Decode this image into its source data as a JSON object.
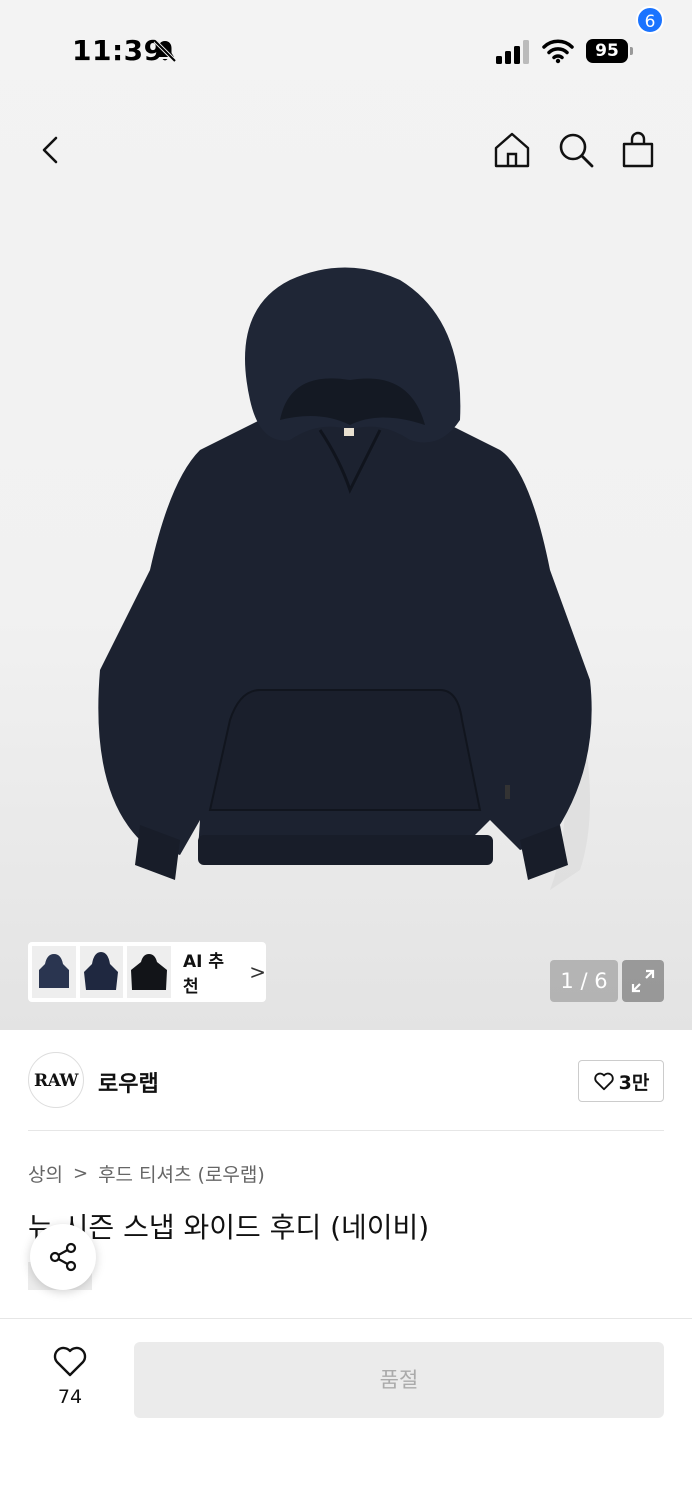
{
  "status_bar": {
    "time": "11:39",
    "battery": "95"
  },
  "nav": {
    "cart_count": "6"
  },
  "gallery": {
    "ai_label": "AI 추천",
    "ai_chevron": ">",
    "page_indicator": "1 / 6"
  },
  "brand": {
    "logo_text": "RAW",
    "name": "로우랩",
    "like_count": "3만"
  },
  "breadcrumb": {
    "category": "상의",
    "separator": ">",
    "subcategory": "후드 티셔츠 (로우랩)"
  },
  "product": {
    "title": "뉴 시즌 스냅 와이드 후디 (네이비)",
    "color": "#1c2230"
  },
  "bottom_bar": {
    "wish_count": "74",
    "soldout_label": "품절"
  },
  "colors": {
    "badge": "#1a73ff",
    "soldout_bg": "#ebebeb"
  }
}
